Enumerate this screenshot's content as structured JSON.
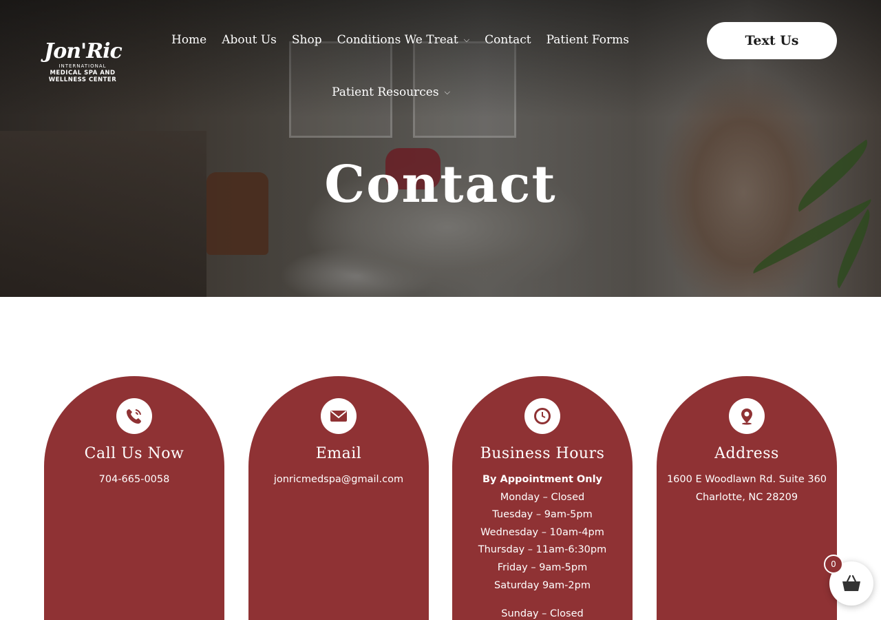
{
  "logo": {
    "script": "Jon'Ric",
    "line": "INTERNATIONAL",
    "sub1": "MEDICAL SPA AND",
    "sub2": "WELLNESS CENTER"
  },
  "nav": {
    "items": [
      {
        "label": "Home"
      },
      {
        "label": "About Us"
      },
      {
        "label": "Shop"
      },
      {
        "label": "Conditions We Treat",
        "has_dropdown": true
      },
      {
        "label": "Contact"
      },
      {
        "label": "Patient Forms"
      },
      {
        "label": "Patient Resources",
        "has_dropdown": true
      }
    ]
  },
  "header": {
    "cta_label": "Text Us"
  },
  "hero": {
    "title": "Contact"
  },
  "cards": [
    {
      "title": "Call Us Now",
      "icon": "phone-icon",
      "lines": [
        "704-665-0058"
      ]
    },
    {
      "title": "Email",
      "icon": "envelope-icon",
      "lines": [
        "jonricmedspa@gmail.com"
      ]
    },
    {
      "title": "Business Hours",
      "icon": "clock-icon",
      "emphasis": "By Appointment Only",
      "lines": [
        "Monday – Closed",
        "Tuesday – 9am-5pm",
        "Wednesday – 10am-4pm",
        "Thursday – 11am-6:30pm",
        "Friday – 9am-5pm",
        "Saturday 9am-2pm"
      ],
      "extra": "Sunday – Closed"
    },
    {
      "title": "Address",
      "icon": "map-pin-icon",
      "lines": [
        "1600 E Woodlawn Rd. Suite 360",
        "Charlotte, NC 28209"
      ]
    }
  ],
  "cart": {
    "count": "0",
    "icon": "basket-icon"
  },
  "colors": {
    "accent": "#8f3234",
    "hero_overlay": "#141414",
    "text_light": "#ffffff"
  }
}
